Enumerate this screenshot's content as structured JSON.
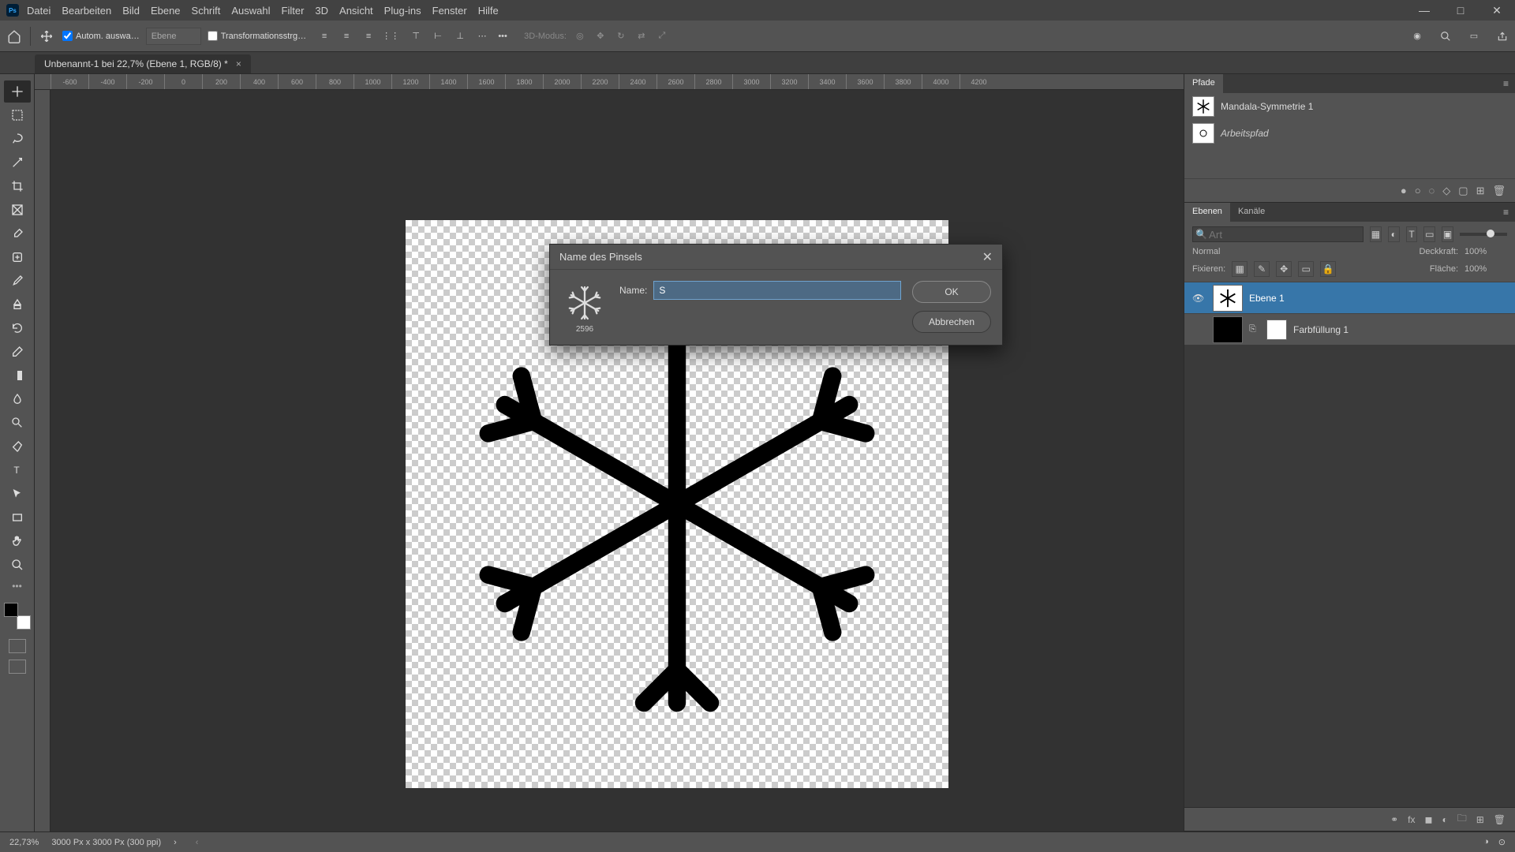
{
  "app": {
    "logo_text": "Ps"
  },
  "menu": [
    "Datei",
    "Bearbeiten",
    "Bild",
    "Ebene",
    "Schrift",
    "Auswahl",
    "Filter",
    "3D",
    "Ansicht",
    "Plug-ins",
    "Fenster",
    "Hilfe"
  ],
  "windowControls": {
    "min": "—",
    "max": "□",
    "close": "✕"
  },
  "optbar": {
    "auto_select_label": "Autom. auswa…",
    "auto_select_mode": "Ebene",
    "transform_label": "Transformationsstrg…",
    "threed_label": "3D-Modus:"
  },
  "doc": {
    "tab_title": "Unbenannt-1 bei 22,7% (Ebene 1, RGB/8) *",
    "ruler_ticks": [
      "-600",
      "-400",
      "-200",
      "0",
      "200",
      "400",
      "600",
      "800",
      "1000",
      "1200",
      "1400",
      "1600",
      "1800",
      "2000",
      "2200",
      "2400",
      "2600",
      "2800",
      "3000",
      "3200",
      "3400",
      "3600",
      "3800",
      "4000",
      "4200"
    ]
  },
  "dialog": {
    "title": "Name des Pinsels",
    "brush_size": "2596",
    "name_label": "Name:",
    "name_value": "S",
    "ok": "OK",
    "cancel": "Abbrechen"
  },
  "paths_panel": {
    "tab": "Pfade",
    "items": [
      {
        "name": "Mandala-Symmetrie 1",
        "italic": false
      },
      {
        "name": "Arbeitspfad",
        "italic": true
      }
    ]
  },
  "layers_panel": {
    "tabs": [
      "Ebenen",
      "Kanäle"
    ],
    "filter_placeholder": "Art",
    "blend_mode": "Normal",
    "opacity_label": "Deckkraft:",
    "opacity_value": "100%",
    "lock_label": "Fixieren:",
    "fill_label": "Fläche:",
    "fill_value": "100%",
    "layers": [
      {
        "name": "Ebene 1",
        "visible": true,
        "selected": true,
        "kind": "pixel"
      },
      {
        "name": "Farbfüllung 1",
        "visible": false,
        "selected": false,
        "kind": "fill"
      }
    ]
  },
  "status": {
    "zoom": "22,73%",
    "docinfo": "3000 Px x 3000 Px (300 ppi)"
  }
}
